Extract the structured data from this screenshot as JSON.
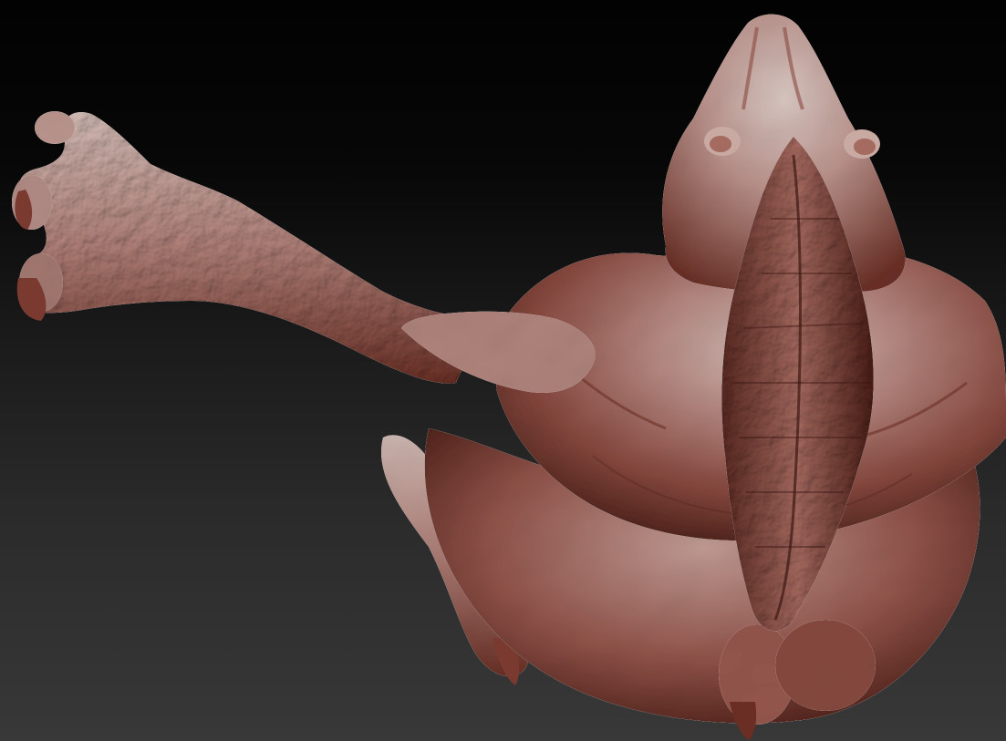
{
  "app": {
    "canvas": {
      "subject": "sculpted-creature-model",
      "material": "clay-red-matcap",
      "background_style": "vertical-gradient-dark"
    },
    "colors": {
      "bg_top": "#020202",
      "bg_bottom": "#383838",
      "clay_highlight": "#cfb6b0",
      "clay_mid": "#a8706a",
      "clay_shadow": "#5a2c24",
      "clay_deep": "#3c1812"
    }
  }
}
